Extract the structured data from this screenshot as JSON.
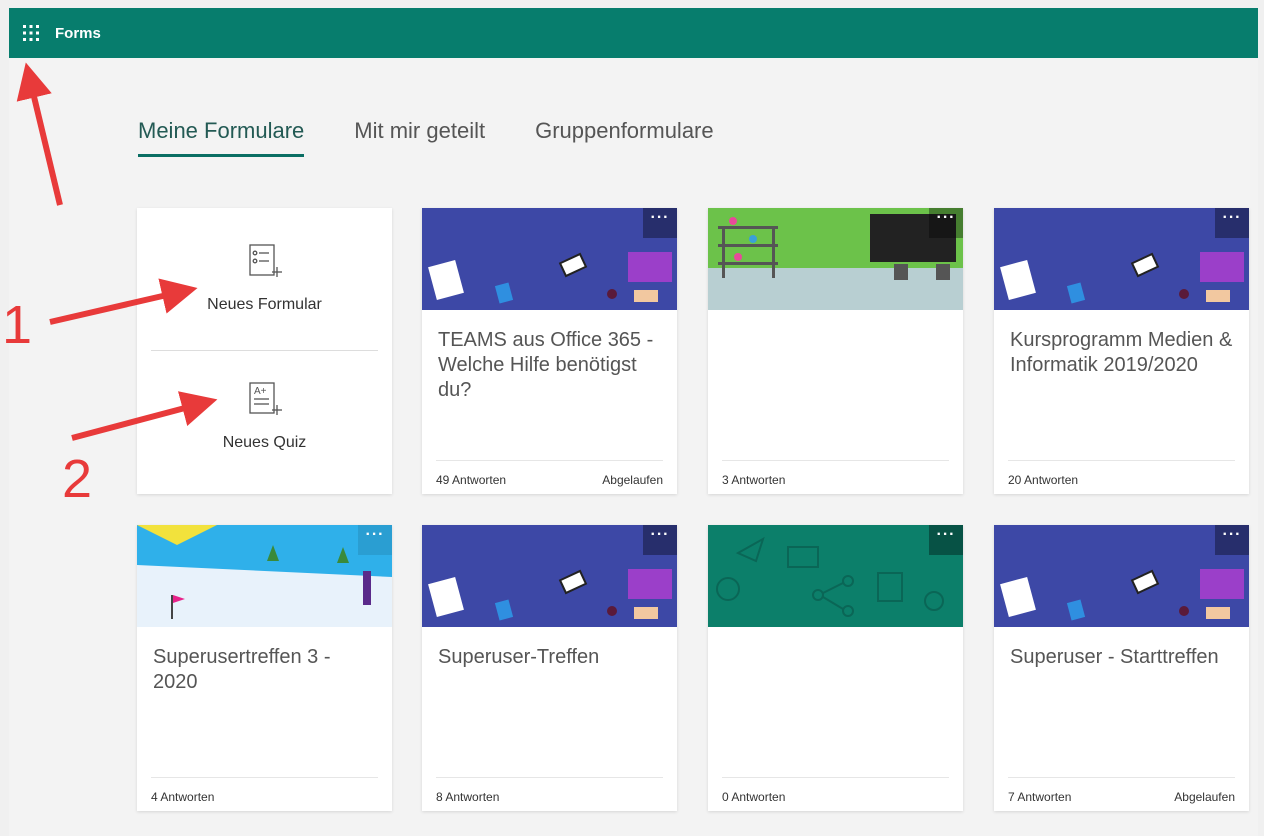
{
  "app": {
    "title": "Forms"
  },
  "tabs": [
    {
      "label": "Meine Formulare",
      "active": true
    },
    {
      "label": "Mit mir geteilt",
      "active": false
    },
    {
      "label": "Gruppenformulare",
      "active": false
    }
  ],
  "new_panel": {
    "new_form_label": "Neues Formular",
    "new_quiz_label": "Neues Quiz"
  },
  "cards": [
    {
      "title": "TEAMS aus Office 365 - Welche Hilfe benötigst du?",
      "responses": "49 Antworten",
      "status": "Abgelaufen",
      "theme": "purple-desk"
    },
    {
      "title": "",
      "responses": "3 Antworten",
      "status": "",
      "theme": "lab"
    },
    {
      "title": "Kursprogramm Medien & Informatik 2019/2020",
      "responses": "20 Antworten",
      "status": "",
      "theme": "purple-desk"
    },
    {
      "title": "Superusertreffen 3 - 2020",
      "responses": "4 Antworten",
      "status": "",
      "theme": "snow"
    },
    {
      "title": "Superuser-Treffen",
      "responses": "8 Antworten",
      "status": "",
      "theme": "purple-desk"
    },
    {
      "title": "",
      "responses": "0 Antworten",
      "status": "",
      "theme": "teal-icons"
    },
    {
      "title": "Superuser - Starttreffen",
      "responses": "7 Antworten",
      "status": "Abgelaufen",
      "theme": "purple-desk"
    }
  ],
  "annotations": {
    "marker_1": "1",
    "marker_2": "2"
  },
  "colors": {
    "brand": "#077d6d",
    "purple_banner": "#3d48a6",
    "teal_banner": "#0c7f6a",
    "lab_green": "#6cc24a",
    "arrow": "#e83a3a"
  },
  "icons": {
    "more": "more-dots-icon",
    "waffle": "app-launcher-icon"
  }
}
